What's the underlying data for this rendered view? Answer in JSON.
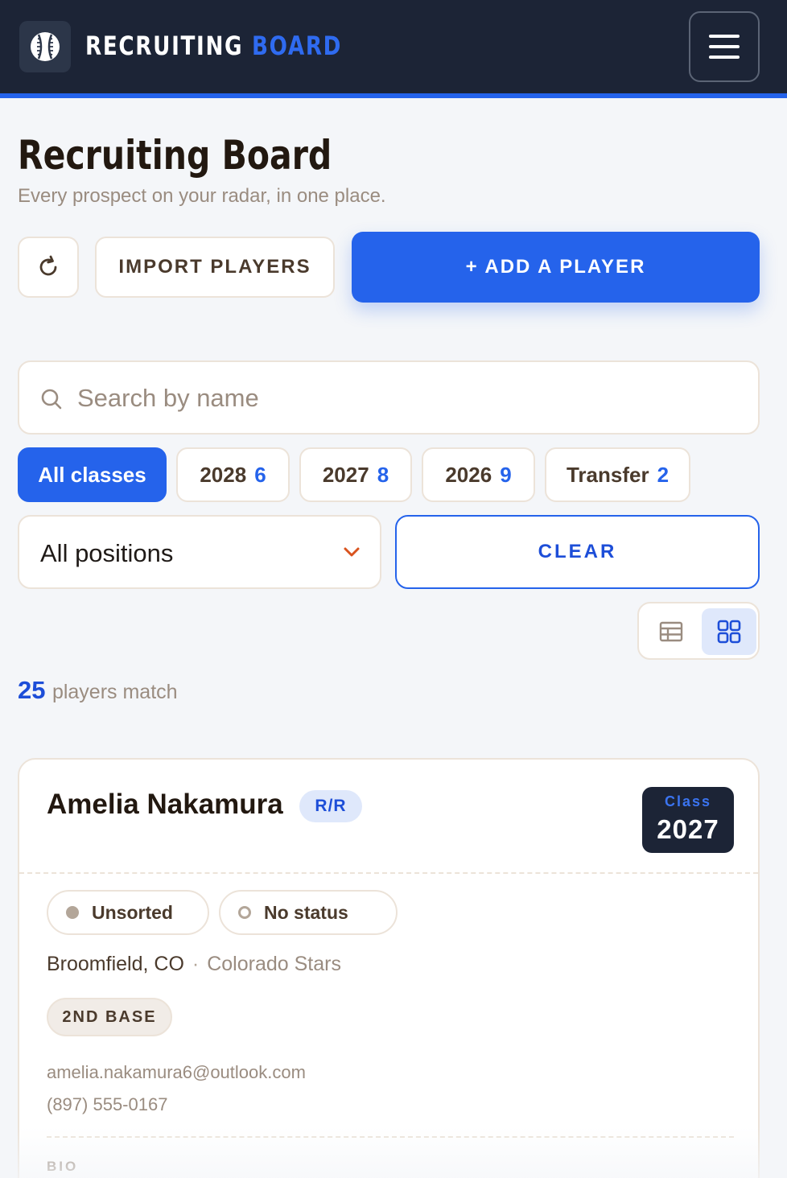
{
  "header": {
    "brand_primary": "RECRUITING",
    "brand_accent": "BOARD",
    "logo_icon": "baseball-icon",
    "menu_icon": "hamburger-menu-icon",
    "accent_color": "#2563eb"
  },
  "page": {
    "title": "Recruiting Board",
    "subtitle": "Every prospect on your radar, in one place."
  },
  "actions": {
    "refresh_icon": "refresh-icon",
    "import_label": "IMPORT PLAYERS",
    "add_label": "+ ADD A PLAYER"
  },
  "search": {
    "placeholder": "Search by name",
    "value": ""
  },
  "class_filters": [
    {
      "label": "All classes",
      "count": "",
      "active": true
    },
    {
      "label": "2028",
      "count": "6",
      "active": false
    },
    {
      "label": "2027",
      "count": "8",
      "active": false
    },
    {
      "label": "2026",
      "count": "9",
      "active": false
    },
    {
      "label": "Transfer",
      "count": "2",
      "active": false
    }
  ],
  "position_filter": {
    "selected": "All positions"
  },
  "clear_label": "CLEAR",
  "view_toggle": {
    "table_icon": "table-view-icon",
    "grid_icon": "grid-view-icon",
    "active": "grid"
  },
  "results": {
    "count": "25",
    "label": "players match"
  },
  "players": [
    {
      "name": "Amelia Nakamura",
      "bats_throws": "R/R",
      "class_label": "Class",
      "class_year": "2027",
      "sort_status": "Unsorted",
      "status": "No status",
      "location": "Broomfield, CO",
      "separator": "·",
      "team": "Colorado Stars",
      "position": "2ND BASE",
      "email": "amelia.nakamura6@outlook.com",
      "phone": "(897) 555-0167",
      "bio_label": "BIO"
    }
  ]
}
